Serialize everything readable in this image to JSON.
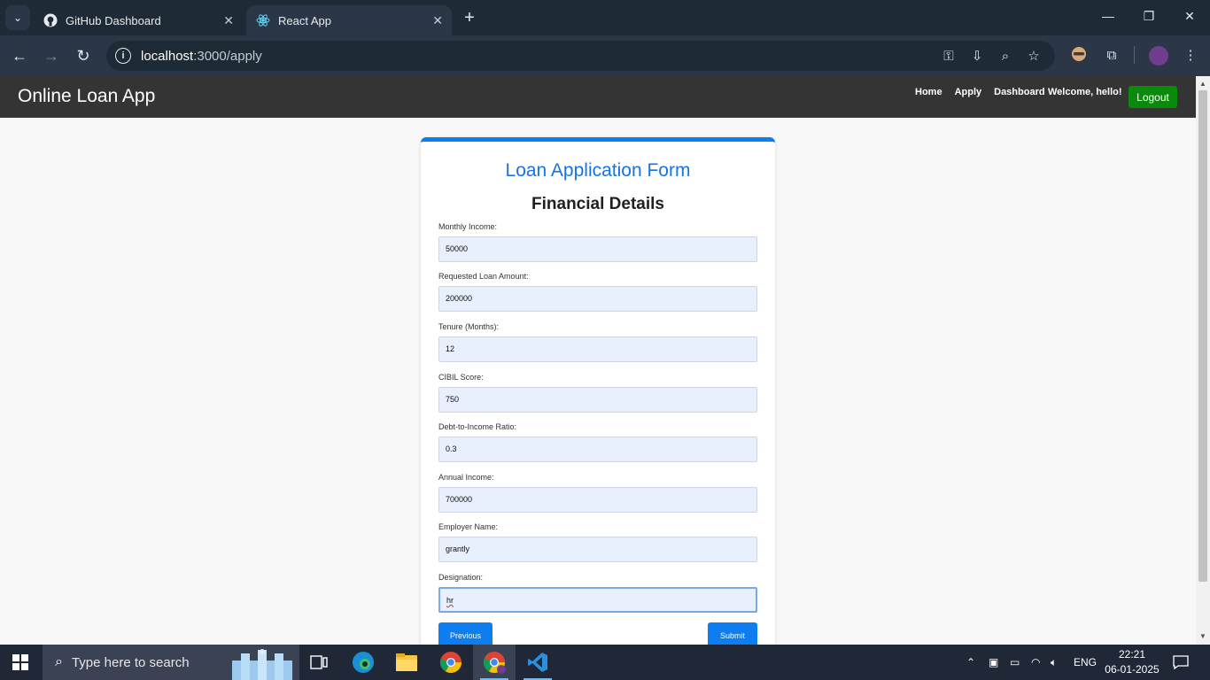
{
  "browser": {
    "tabs": [
      {
        "title": "GitHub Dashboard",
        "active": false,
        "favicon": "github-icon"
      },
      {
        "title": "React App",
        "active": true,
        "favicon": "react-icon"
      }
    ],
    "url_host": "localhost",
    "url_path": ":3000/apply",
    "colors": {
      "tabstrip": "#1f2a37",
      "toolbar": "#2b3746"
    }
  },
  "app": {
    "brand": "Online Loan App",
    "nav": {
      "home": "Home",
      "apply": "Apply",
      "dashboard": "Dashboard"
    },
    "welcome": "Welcome, hello!",
    "logout": "Logout"
  },
  "form": {
    "title": "Loan Application Form",
    "section": "Financial Details",
    "fields": [
      {
        "label": "Monthly Income:",
        "value": "50000"
      },
      {
        "label": "Requested Loan Amount:",
        "value": "200000"
      },
      {
        "label": "Tenure (Months):",
        "value": "12"
      },
      {
        "label": "CIBIL Score:",
        "value": "750"
      },
      {
        "label": "Debt-to-Income Ratio:",
        "value": "0.3"
      },
      {
        "label": "Annual Income:",
        "value": "700000"
      },
      {
        "label": "Employer Name:",
        "value": "grantly"
      },
      {
        "label": "Designation:",
        "value": "hr"
      }
    ],
    "previous": "Previous",
    "submit": "Submit",
    "colors": {
      "accent": "#0d7df0",
      "title": "#1773e6",
      "input_bg": "#e8f0fe",
      "logout": "#0a8a0a"
    }
  },
  "taskbar": {
    "search_placeholder": "Type here to search",
    "language": "ENG",
    "time": "22:21",
    "date": "06-01-2025"
  }
}
